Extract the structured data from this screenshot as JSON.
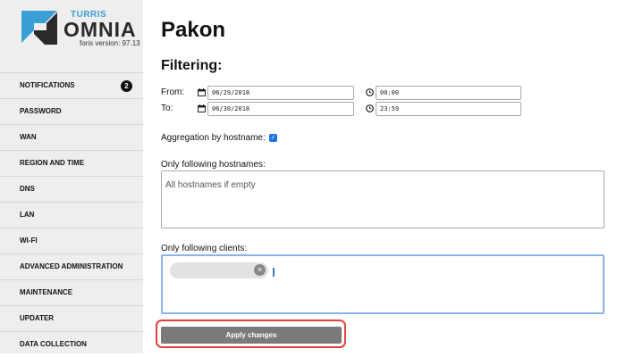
{
  "brand": {
    "small": "TURRIS",
    "big": "OMNIA",
    "version": "foris version: 97.13"
  },
  "sidebar": {
    "items": [
      {
        "label": "NOTIFICATIONS",
        "badge": "2"
      },
      {
        "label": "PASSWORD"
      },
      {
        "label": "WAN"
      },
      {
        "label": "REGION AND TIME"
      },
      {
        "label": "DNS"
      },
      {
        "label": "LAN"
      },
      {
        "label": "WI-FI"
      },
      {
        "label": "ADVANCED ADMINISTRATION"
      },
      {
        "label": "MAINTENANCE"
      },
      {
        "label": "UPDATER"
      },
      {
        "label": "DATA COLLECTION"
      }
    ]
  },
  "page": {
    "title": "Pakon",
    "section": "Filtering:"
  },
  "filter": {
    "from_label": "From:",
    "to_label": "To:",
    "from_date": "06/29/2018",
    "from_time": "00:00",
    "to_date": "06/30/2018",
    "to_time": "23:59",
    "aggregation_label": "Aggregation by hostname:",
    "aggregation_checked": "✓",
    "hostnames_label": "Only following hostnames:",
    "hostnames_placeholder": "All hostnames if empty",
    "clients_label": "Only following clients:",
    "chip_remove": "×",
    "apply_label": "Apply changes"
  },
  "colors": {
    "accent": "#3a9fd6",
    "highlight": "#e0403a",
    "checkbox": "#1a73e8"
  }
}
